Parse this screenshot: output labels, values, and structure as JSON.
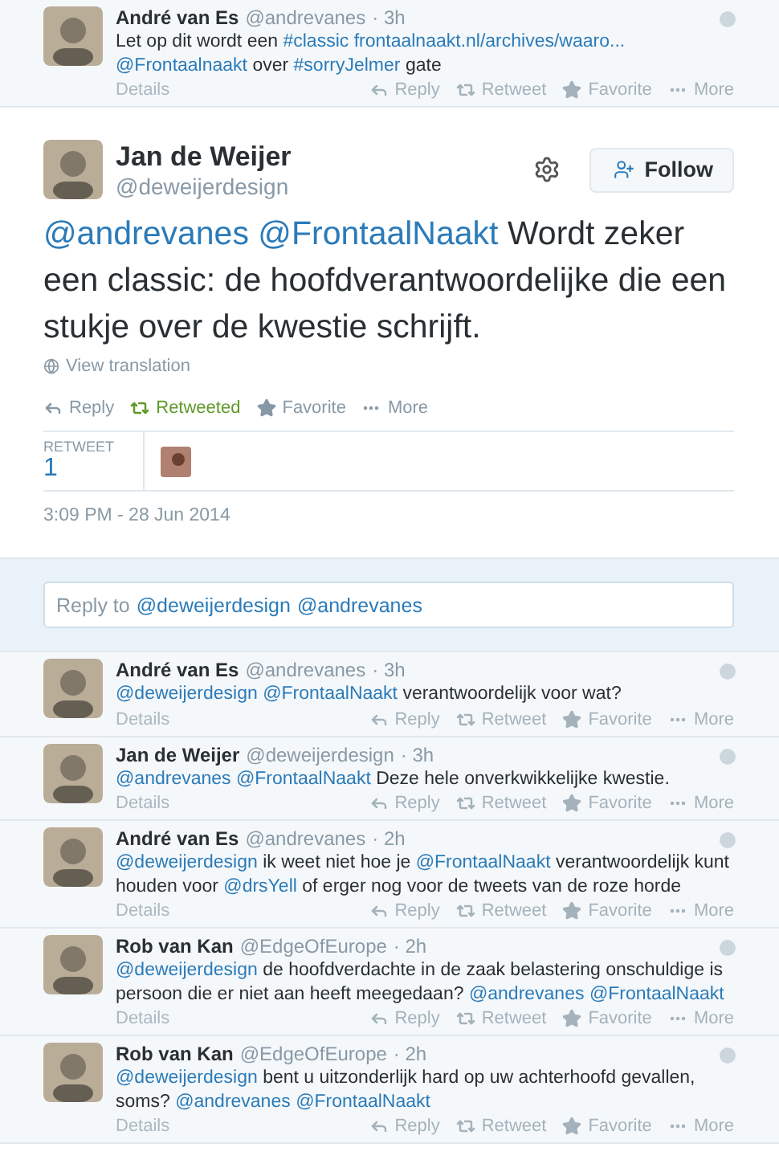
{
  "previous_tweet": {
    "name": "André van Es",
    "handle": "@andrevanes",
    "time": "· 3h",
    "text": [
      {
        "kind": "plain",
        "text": "Let op dit wordt een"
      },
      {
        "kind": "link",
        "text": "#classic"
      },
      {
        "kind": "link",
        "text": "frontaalnaakt.nl/archives/waaro..."
      },
      {
        "kind": "link",
        "text": "@Frontaalnaakt"
      },
      {
        "kind": "plain",
        "text": "over"
      },
      {
        "kind": "link",
        "text": "#sorryJelmer"
      },
      {
        "kind": "plain",
        "text": "gate"
      }
    ],
    "details": "Details",
    "actions": [
      {
        "kind": "reply",
        "label": "Reply"
      },
      {
        "kind": "retweet",
        "label": "Retweet"
      },
      {
        "kind": "favorite",
        "label": "Favorite"
      },
      {
        "kind": "more",
        "label": "More"
      }
    ]
  },
  "main_tweet": {
    "name": "Jan de Weijer",
    "handle": "@deweijerdesign",
    "follow_label": "Follow",
    "text": [
      {
        "kind": "link",
        "text": "@andrevanes"
      },
      {
        "kind": "link",
        "text": "@FrontaalNaakt"
      },
      {
        "kind": "plain",
        "text": "Wordt zeker een classic: de hoofdverantwoordelijke die een stukje over de kwestie schrijft."
      }
    ],
    "translation": "View translation",
    "actions": [
      {
        "kind": "reply",
        "label": "Reply",
        "on": false
      },
      {
        "kind": "retweet",
        "label": "Retweeted",
        "on": true
      },
      {
        "kind": "favorite",
        "label": "Favorite",
        "on": false
      },
      {
        "kind": "more",
        "label": "More",
        "on": false
      }
    ],
    "stats_label": "RETWEET",
    "stats_count": "1",
    "date": "3:09 PM - 28 Jun 2014"
  },
  "reply_box": {
    "prefix": "Reply to",
    "mentions": [
      "@deweijerdesign",
      "@andrevanes"
    ]
  },
  "replies": [
    {
      "name": "André van Es",
      "handle": "@andrevanes",
      "time": "· 3h",
      "text": [
        {
          "kind": "link",
          "text": "@deweijerdesign"
        },
        {
          "kind": "link",
          "text": "@FrontaalNaakt"
        },
        {
          "kind": "plain",
          "text": "verantwoordelijk voor wat?"
        }
      ],
      "details": "Details",
      "actions": [
        {
          "kind": "reply",
          "label": "Reply"
        },
        {
          "kind": "retweet",
          "label": "Retweet"
        },
        {
          "kind": "favorite",
          "label": "Favorite"
        },
        {
          "kind": "more",
          "label": "More"
        }
      ]
    },
    {
      "name": "Jan de Weijer",
      "handle": "@deweijerdesign",
      "time": "· 3h",
      "text": [
        {
          "kind": "link",
          "text": "@andrevanes"
        },
        {
          "kind": "link",
          "text": "@FrontaalNaakt"
        },
        {
          "kind": "plain",
          "text": "Deze hele onverkwikkelijke kwestie."
        }
      ],
      "details": "Details",
      "actions": [
        {
          "kind": "reply",
          "label": "Reply"
        },
        {
          "kind": "retweet",
          "label": "Retweet"
        },
        {
          "kind": "favorite",
          "label": "Favorite"
        },
        {
          "kind": "more",
          "label": "More"
        }
      ]
    },
    {
      "name": "André van Es",
      "handle": "@andrevanes",
      "time": "· 2h",
      "text": [
        {
          "kind": "link",
          "text": "@deweijerdesign"
        },
        {
          "kind": "plain",
          "text": "ik weet niet hoe je"
        },
        {
          "kind": "link",
          "text": "@FrontaalNaakt"
        },
        {
          "kind": "plain",
          "text": "verantwoordelijk kunt houden voor"
        },
        {
          "kind": "link",
          "text": "@drsYell"
        },
        {
          "kind": "plain",
          "text": "of erger nog voor de tweets van de roze horde"
        }
      ],
      "details": "Details",
      "actions": [
        {
          "kind": "reply",
          "label": "Reply"
        },
        {
          "kind": "retweet",
          "label": "Retweet"
        },
        {
          "kind": "favorite",
          "label": "Favorite"
        },
        {
          "kind": "more",
          "label": "More"
        }
      ]
    },
    {
      "name": "Rob van Kan",
      "handle": "@EdgeOfEurope",
      "time": "· 2h",
      "text": [
        {
          "kind": "link",
          "text": "@deweijerdesign"
        },
        {
          "kind": "plain",
          "text": "de hoofdverdachte in de zaak belastering onschuldige is persoon die er niet aan heeft meegedaan?"
        },
        {
          "kind": "link",
          "text": "@andrevanes"
        },
        {
          "kind": "link",
          "text": "@FrontaalNaakt"
        }
      ],
      "details": "Details",
      "actions": [
        {
          "kind": "reply",
          "label": "Reply"
        },
        {
          "kind": "retweet",
          "label": "Retweet"
        },
        {
          "kind": "favorite",
          "label": "Favorite"
        },
        {
          "kind": "more",
          "label": "More"
        }
      ]
    },
    {
      "name": "Rob van Kan",
      "handle": "@EdgeOfEurope",
      "time": "· 2h",
      "text": [
        {
          "kind": "link",
          "text": "@deweijerdesign"
        },
        {
          "kind": "plain",
          "text": "bent u uitzonderlijk hard op uw achterhoofd gevallen, soms?"
        },
        {
          "kind": "link",
          "text": "@andrevanes"
        },
        {
          "kind": "link",
          "text": "@FrontaalNaakt"
        }
      ],
      "details": "Details",
      "actions": [
        {
          "kind": "reply",
          "label": "Reply"
        },
        {
          "kind": "retweet",
          "label": "Retweet"
        },
        {
          "kind": "favorite",
          "label": "Favorite"
        },
        {
          "kind": "more",
          "label": "More"
        }
      ]
    }
  ]
}
